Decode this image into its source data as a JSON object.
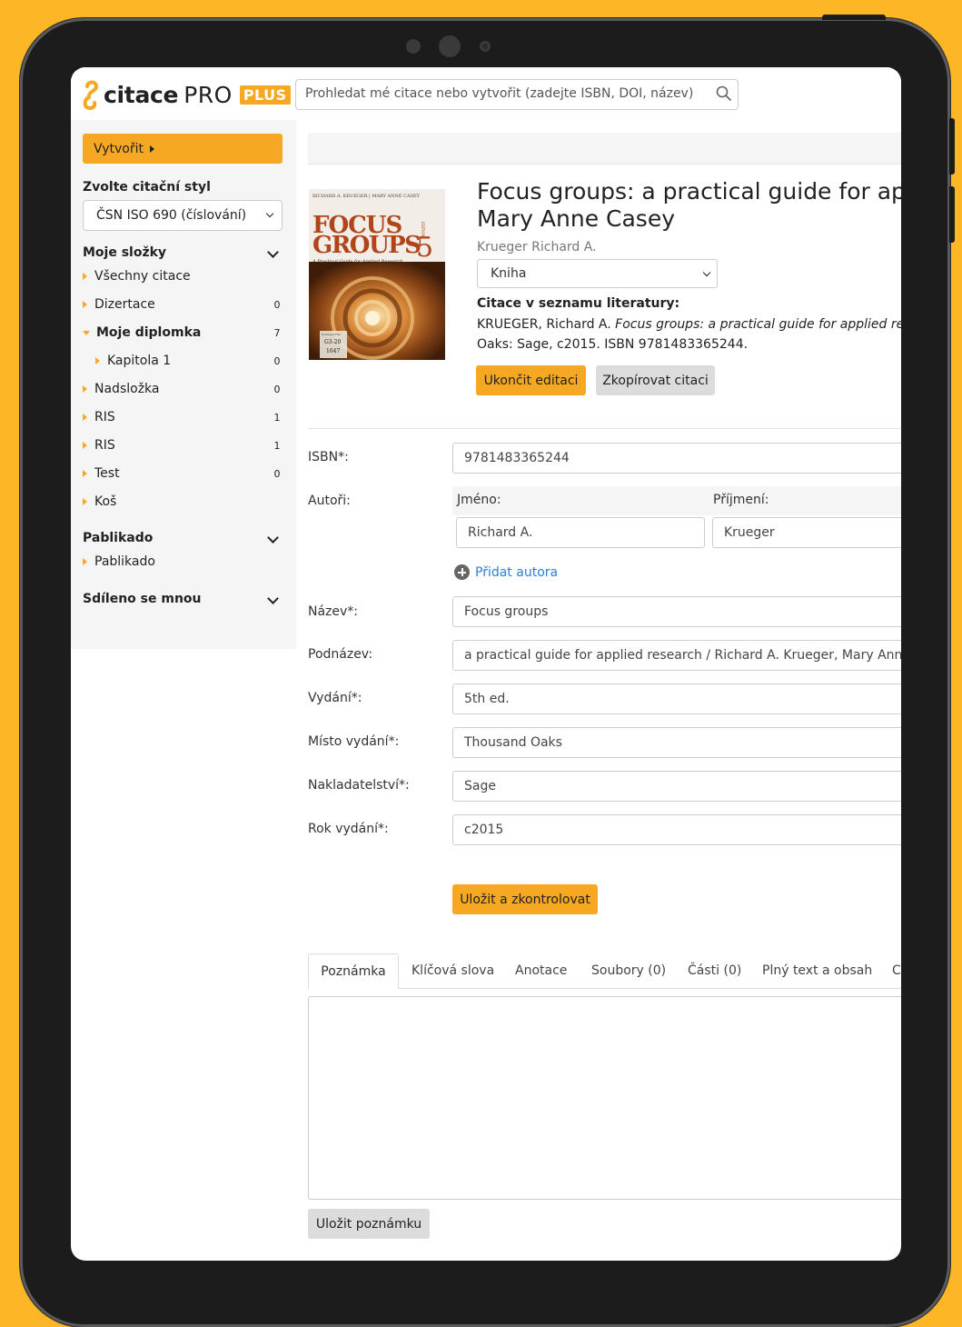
{
  "header": {
    "logo_word": "citace",
    "logo_pro": "PRO",
    "logo_plus": "PLUS",
    "search_placeholder": "Prohledat mé citace nebo vytvořit (zadejte ISBN, DOI, název)"
  },
  "sidebar": {
    "create_label": "Vytvořit",
    "style_heading": "Zvolte citační styl",
    "style_value": "ČSN ISO 690 (číslování)",
    "my_folders_heading": "Moje složky",
    "folders": [
      {
        "label": "Všechny citace",
        "count": ""
      },
      {
        "label": "Dizertace",
        "count": "0"
      },
      {
        "label": "Moje diplomka",
        "count": "7"
      },
      {
        "label": "Kapitola 1",
        "count": "0"
      },
      {
        "label": "Nadsložka",
        "count": "0"
      },
      {
        "label": "RIS",
        "count": "1"
      },
      {
        "label": "RIS",
        "count": "1"
      },
      {
        "label": "Test",
        "count": "0"
      },
      {
        "label": "Koš",
        "count": ""
      }
    ],
    "pablikado_heading": "Pablikado",
    "pablikado_item": "Pablikado",
    "shared_heading": "Sdíleno se mnou"
  },
  "book": {
    "title_line1": "Focus groups: a practical guide for appl",
    "title_line2": "Mary Anne Casey",
    "author": "Krueger Richard A.",
    "type": "Kniha",
    "citation_heading": "Citace v seznamu literatury:",
    "citation_prefix": "KRUEGER, Richard A. ",
    "citation_italic": "Focus groups: a practical guide for applied resear",
    "citation_rest": "Oaks: Sage, c2015. ISBN 9781483365244.",
    "cover": {
      "authors": "RICHARD A. KRUEGER | MARY ANNE CASEY",
      "title1": "FOCUS",
      "title2": "GROUPS",
      "edition": "5",
      "edition_word": "EDITION",
      "subtitle": "A Practical Guide for Applied Research",
      "shelf1": "G3-20",
      "shelf2": "1647",
      "shelf_top": "Knihovna FSV"
    }
  },
  "actions": {
    "finish_edit": "Ukončit editaci",
    "copy_citation": "Zkopírovat citaci",
    "save_check": "Uložit a zkontrolovat",
    "save_note": "Uložit poznámku"
  },
  "form": {
    "isbn_label": "ISBN*:",
    "isbn_value": "9781483365244",
    "authors_label": "Autoři:",
    "first_name_head": "Jméno:",
    "last_name_head": "Příjmení:",
    "first_name_value": "Richard A.",
    "last_name_value": "Krueger",
    "add_author": "Přidat autora",
    "title_label": "Název*:",
    "title_value": "Focus groups",
    "subtitle_label": "Podnázev:",
    "subtitle_value": "a practical guide for applied research / Richard A. Krueger, Mary Anne Ca",
    "edition_label": "Vydání*:",
    "edition_value": "5th ed.",
    "place_label": "Místo vydání*:",
    "place_value": "Thousand Oaks",
    "publisher_label": "Nakladatelství*:",
    "publisher_value": "Sage",
    "year_label": "Rok vydání*:",
    "year_value": "c2015"
  },
  "tabs": [
    "Poznámka",
    "Klíčová slova",
    "Anotace",
    "Soubory (0)",
    "Části (0)",
    "Plný text a obsah",
    "C"
  ],
  "colors": {
    "accent": "#f7a823",
    "background": "#fdb625",
    "link": "#2d7fd8"
  }
}
